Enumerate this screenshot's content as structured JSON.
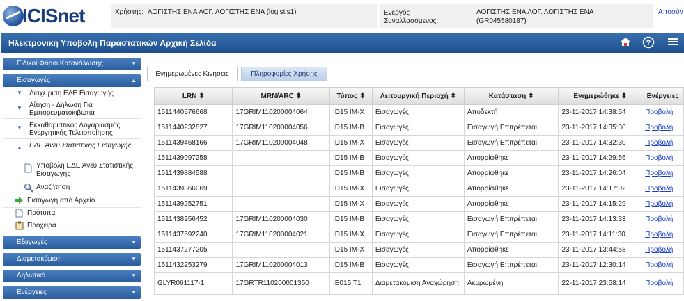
{
  "header": {
    "logo_text": "ICISnet",
    "user_label": "Χρήστης:",
    "user_value": "ΛΟΓΙΣΤΗΣ ΕΝΑ ΛΟΓ. ΛΟΓΙΣΤΗΣ ΕΝΑ (logistis1)",
    "trader_label_1": "Ενεργός",
    "trader_label_2": "Συναλλασόμενος:",
    "trader_value_1": "ΛΟΓΙΣΤΗΣ ΕΝΑ ΛΟΓ. ΛΟΓΙΣΤΗΣ ΕΝΑ",
    "trader_value_2": "(GR045580187)",
    "logout": "Αποσύν"
  },
  "titlebar": {
    "title": "Ηλεκτρονική Υποβολή Παραστατικών Αρχική Σελίδα",
    "icons": [
      "home-icon",
      "help-icon",
      "menu-icon"
    ]
  },
  "sidebar": {
    "sections": [
      {
        "label": "Ειδικοί Φόροι Κατανάλωσης"
      },
      {
        "label": "Εισαγωγές"
      },
      {
        "label": "Εξαγωγές"
      },
      {
        "label": "Διαμετακόμιση"
      },
      {
        "label": "Δηλωτικά"
      },
      {
        "label": "Ενέργειες"
      }
    ],
    "subs": [
      {
        "label": "Διαχείριση ΕΔΕ Εισαγωγής"
      },
      {
        "label": "Αίτηση - Δήλωση Για Εμπορευματοκιβώτια"
      },
      {
        "label": "Εκκαθαριστικός Λογαριασμός Ενεργητικής Τελειοποίησης"
      },
      {
        "label": "ΕΔΕ Άνευ Στατιστικής Εισαγωγής"
      }
    ],
    "leaves": [
      {
        "label": "Υποβολή ΕΔΕ Άνευ Στατιστικής Εισαγωγής"
      },
      {
        "label": "Αναζήτηση"
      },
      {
        "label": "Εισαγωγή από Αρχείο"
      },
      {
        "label": "Πρότυπα"
      },
      {
        "label": "Πρόχειρα"
      }
    ]
  },
  "tabs": [
    {
      "label": "Ενημερωμένες Κινήσεις"
    },
    {
      "label": "Πληροφορίες Χρήσης"
    }
  ],
  "table": {
    "headers": [
      "LRN ⬍",
      "MRN/ARC ⬍",
      "Τύπος ⬍",
      "Λειτουργική Περιοχή ⬍",
      "Κατάσταση ⬍",
      "Ενημερώθηκε ⬍",
      "Ενέργειες"
    ],
    "rows": [
      [
        "1511440576668",
        "17GRIM110200004064",
        "ID15 IM-X",
        "Εισαγωγές",
        "Αποδεκτή",
        "23-11-2017 14:38:54",
        "Προβολή"
      ],
      [
        "1511440232827",
        "17GRIM110200004056",
        "ID15 IM-B",
        "Εισαγωγές",
        "Εισαγωγή Επιτρέπεται",
        "23-11-2017 14:35:30",
        "Προβολή"
      ],
      [
        "1511439468166",
        "17GRIM110200004048",
        "ID15 IM-X",
        "Εισαγωγές",
        "Εισαγωγή Επιτρέπεται",
        "23-11-2017 14:32:30",
        "Προβολή"
      ],
      [
        "1511439997258",
        "",
        "ID15 IM-B",
        "Εισαγωγές",
        "Απορρίφθηκε",
        "23-11-2017 14:29:56",
        "Προβολή"
      ],
      [
        "1511439884588",
        "",
        "ID15 IM-B",
        "Εισαγωγές",
        "Απορρίφθηκε",
        "23-11-2017 14:26:04",
        "Προβολή"
      ],
      [
        "1511439366069",
        "",
        "ID15 IM-X",
        "Εισαγωγές",
        "Απορρίφθηκε",
        "23-11-2017 14:17:02",
        "Προβολή"
      ],
      [
        "1511439252751",
        "",
        "ID15 IM-X",
        "Εισαγωγές",
        "Απορρίφθηκε",
        "23-11-2017 14:15:29",
        "Προβολή"
      ],
      [
        "1511438956452",
        "17GRIM110200004030",
        "ID15 IM-B",
        "Εισαγωγές",
        "Εισαγωγή Επιτρέπεται",
        "23-11-2017 14:13:33",
        "Προβολή"
      ],
      [
        "1511437592240",
        "17GRIM110200004021",
        "ID15 IM-X",
        "Εισαγωγές",
        "Εισαγωγή Επιτρέπεται",
        "23-11-2017 14:11:30",
        "Προβολή"
      ],
      [
        "1511437277205",
        "",
        "ID15 IM-X",
        "Εισαγωγές",
        "Απορρίφθηκε",
        "23-11-2017 13:44:58",
        "Προβολή"
      ],
      [
        "1511432253279",
        "17GRIM110200004013",
        "ID15 IM-B",
        "Εισαγωγές",
        "Εισαγωγή Επιτρέπεται",
        "23-11-2017 12:30:14",
        "Προβολή"
      ],
      [
        "GLYR061117-1",
        "17GRTR110200001350",
        "IE015 T1",
        "Διαμετακόμιση Αναχώρηση",
        "Ακυρωμένη",
        "22-11-2017 23:58:14",
        "Προβολή"
      ]
    ]
  }
}
